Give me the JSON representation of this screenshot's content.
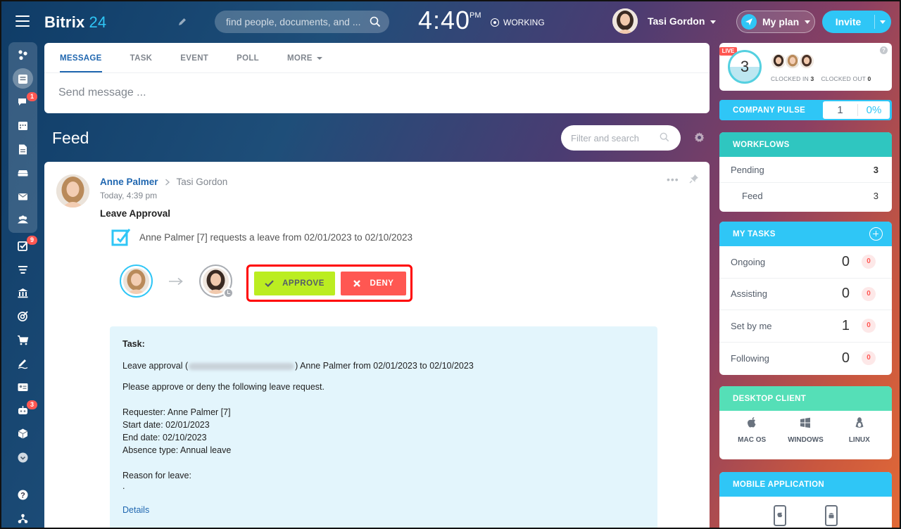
{
  "app": {
    "logo_name": "Bitrix",
    "logo_number": "24",
    "search_placeholder": "find people, documents, and ...",
    "clock_time": "4:40",
    "clock_ampm": "PM",
    "work_status": "WORKING",
    "user_name": "Tasi Gordon",
    "plan_label": "My plan",
    "invite_label": "Invite"
  },
  "sidebar": {
    "items": [
      {
        "icon": "sites-icon",
        "badge": ""
      },
      {
        "icon": "feed-icon",
        "badge": "",
        "active": true
      },
      {
        "icon": "chat-icon",
        "badge": "1"
      },
      {
        "icon": "calendar-icon",
        "badge": ""
      },
      {
        "icon": "documents-icon",
        "badge": ""
      },
      {
        "icon": "drive-icon",
        "badge": ""
      },
      {
        "icon": "mail-icon",
        "badge": ""
      },
      {
        "icon": "employees-icon",
        "badge": ""
      },
      {
        "icon": "tasks-icon",
        "badge": "9"
      },
      {
        "icon": "crm-icon",
        "badge": ""
      },
      {
        "icon": "company-icon",
        "badge": ""
      },
      {
        "icon": "marketing-icon",
        "badge": ""
      },
      {
        "icon": "shop-icon",
        "badge": ""
      },
      {
        "icon": "sign-icon",
        "badge": ""
      },
      {
        "icon": "contact-card-icon",
        "badge": ""
      },
      {
        "icon": "automation-icon",
        "badge": "3"
      },
      {
        "icon": "inventory-icon",
        "badge": ""
      },
      {
        "icon": "more-icon",
        "badge": ""
      },
      {
        "icon": "help-icon",
        "badge": ""
      },
      {
        "icon": "structure-icon",
        "badge": ""
      }
    ]
  },
  "composer": {
    "tabs": [
      "MESSAGE",
      "TASK",
      "EVENT",
      "POLL",
      "MORE"
    ],
    "placeholder": "Send message ..."
  },
  "feed": {
    "title": "Feed",
    "filter_placeholder": "Filter and search"
  },
  "post": {
    "author": "Anne Palmer",
    "recipient": "Tasi Gordon",
    "time": "Today, 4:39 pm",
    "title": "Leave Approval",
    "request_text": "Anne Palmer [7] requests a leave from 02/01/2023 to 02/10/2023",
    "approve_label": "APPROVE",
    "deny_label": "DENY",
    "task": {
      "heading": "Task:",
      "line_prefix": "Leave approval (",
      "line_suffix": ") Anne Palmer from 02/01/2023 to 02/10/2023",
      "instruction": "Please approve or deny the following leave request.",
      "requester": "Requester: Anne Palmer [7]",
      "start": "Start date: 02/01/2023",
      "end": "End date: 02/10/2023",
      "absence": "Absence type: Annual leave",
      "reason_label": "Reason for leave:",
      "reason_value": ".",
      "details_link": "Details"
    }
  },
  "clock_widget": {
    "live": "LIVE",
    "count": "3",
    "clocked_in_label": "CLOCKED IN",
    "clocked_in_value": "3",
    "clocked_out_label": "CLOCKED OUT",
    "clocked_out_value": "0",
    "help": "?"
  },
  "company_pulse": {
    "label": "COMPANY PULSE",
    "value": "1",
    "percent": "0%"
  },
  "workflows": {
    "title": "WORKFLOWS",
    "rows": [
      {
        "label": "Pending",
        "value": "3"
      },
      {
        "label": "Feed",
        "value": "3"
      }
    ]
  },
  "my_tasks": {
    "title": "MY TASKS",
    "rows": [
      {
        "label": "Ongoing",
        "count": "0",
        "badge": "0"
      },
      {
        "label": "Assisting",
        "count": "0",
        "badge": "0"
      },
      {
        "label": "Set by me",
        "count": "1",
        "badge": "0"
      },
      {
        "label": "Following",
        "count": "0",
        "badge": "0"
      }
    ]
  },
  "desktop_client": {
    "title": "DESKTOP CLIENT",
    "os": [
      "MAC OS",
      "WINDOWS",
      "LINUX"
    ]
  },
  "mobile_app": {
    "title": "MOBILE APPLICATION"
  },
  "colors": {
    "accent": "#2fc6f6",
    "link": "#2067b0",
    "approve": "#bbed21",
    "deny": "#ff5752",
    "highlight_border": "#ff0000",
    "workflows_header": "#2fc6c0",
    "desktop_header": "#55dfb7"
  }
}
